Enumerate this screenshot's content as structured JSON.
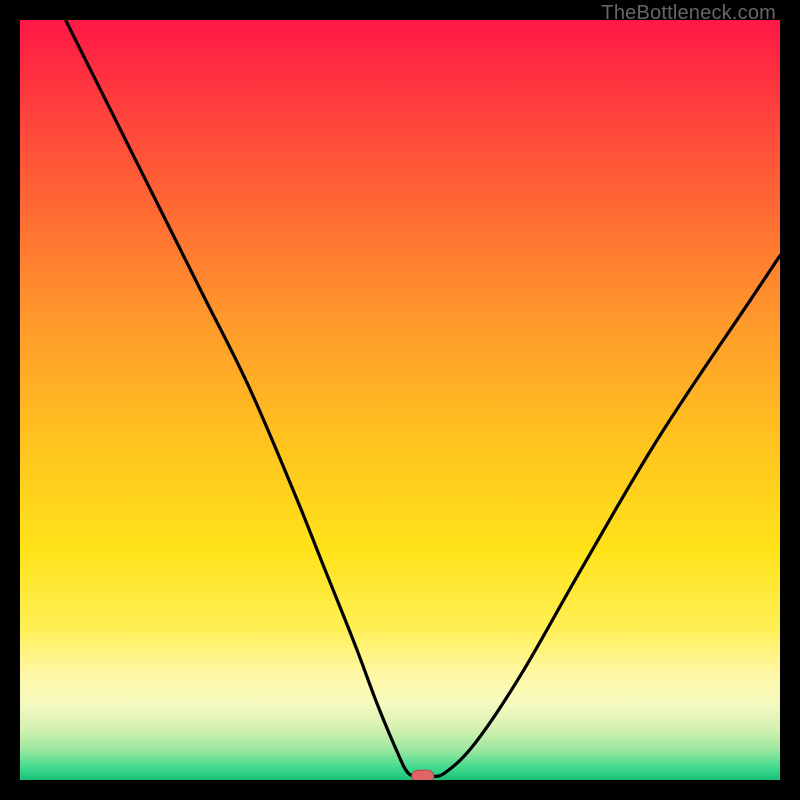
{
  "watermark": "TheBottleneck.com",
  "colors": {
    "frame": "#000000",
    "curve": "#000000",
    "marker_fill": "#e06666",
    "marker_stroke": "#b04747",
    "gradient_stops": [
      {
        "offset": 0.0,
        "color": "#ff1846"
      },
      {
        "offset": 0.1,
        "color": "#ff3a3e"
      },
      {
        "offset": 0.25,
        "color": "#ff6a33"
      },
      {
        "offset": 0.4,
        "color": "#ff9a2b"
      },
      {
        "offset": 0.55,
        "color": "#ffc21f"
      },
      {
        "offset": 0.7,
        "color": "#ffe31a"
      },
      {
        "offset": 0.8,
        "color": "#ffef55"
      },
      {
        "offset": 0.86,
        "color": "#fff7a5"
      },
      {
        "offset": 0.9,
        "color": "#f6fac0"
      },
      {
        "offset": 0.93,
        "color": "#d7f2b1"
      },
      {
        "offset": 0.96,
        "color": "#9de8a0"
      },
      {
        "offset": 0.985,
        "color": "#3ed98e"
      },
      {
        "offset": 1.0,
        "color": "#17c176"
      }
    ]
  },
  "chart_data": {
    "type": "line",
    "title": "",
    "xlabel": "",
    "ylabel": "",
    "xlim": [
      0,
      100
    ],
    "ylim": [
      0,
      100
    ],
    "grid": false,
    "series": [
      {
        "name": "bottleneck-curve",
        "x": [
          6,
          12,
          18,
          24,
          30,
          36,
          40,
          44,
          47,
          49.5,
          51,
          52.5,
          54,
          56,
          60,
          66,
          74,
          84,
          96,
          100
        ],
        "y": [
          100,
          88,
          76,
          64,
          52,
          38,
          28,
          18,
          10,
          4,
          1,
          0.5,
          0.5,
          1,
          5,
          14,
          28,
          45,
          63,
          69
        ]
      }
    ],
    "annotations": [
      {
        "name": "optimal-marker",
        "x": 53,
        "y": 0.5,
        "shape": "pill"
      }
    ]
  }
}
